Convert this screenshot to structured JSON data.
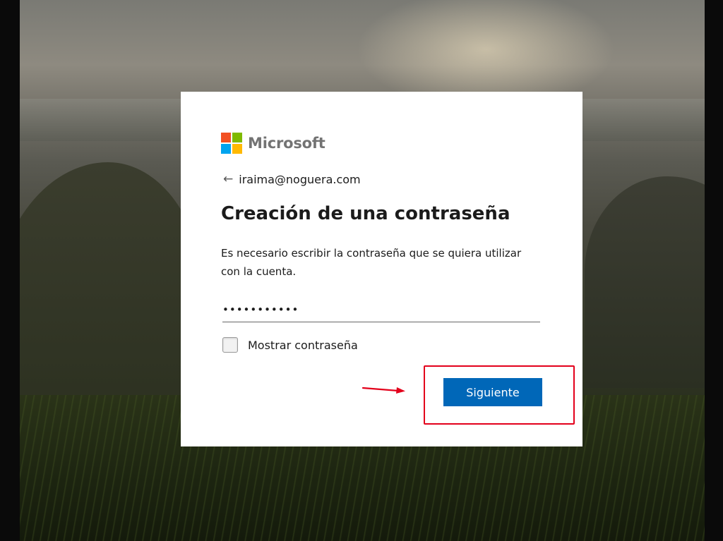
{
  "brand": {
    "name": "Microsoft",
    "logo_colors": [
      "#f25022",
      "#7fba00",
      "#00a4ef",
      "#ffb900"
    ]
  },
  "identity": {
    "back_icon": "arrow-left-icon",
    "email": "iraima@noguera.com"
  },
  "page": {
    "title": "Creación de una contraseña",
    "description": "Es necesario escribir la contraseña que se quiera utilizar con la cuenta."
  },
  "password": {
    "value": "•••••••••••"
  },
  "show_password": {
    "label": "Mostrar contraseña",
    "checked": false
  },
  "actions": {
    "next_label": "Siguiente",
    "accent": "#0067b8"
  },
  "annotation": {
    "highlight_color": "#e3001b"
  }
}
